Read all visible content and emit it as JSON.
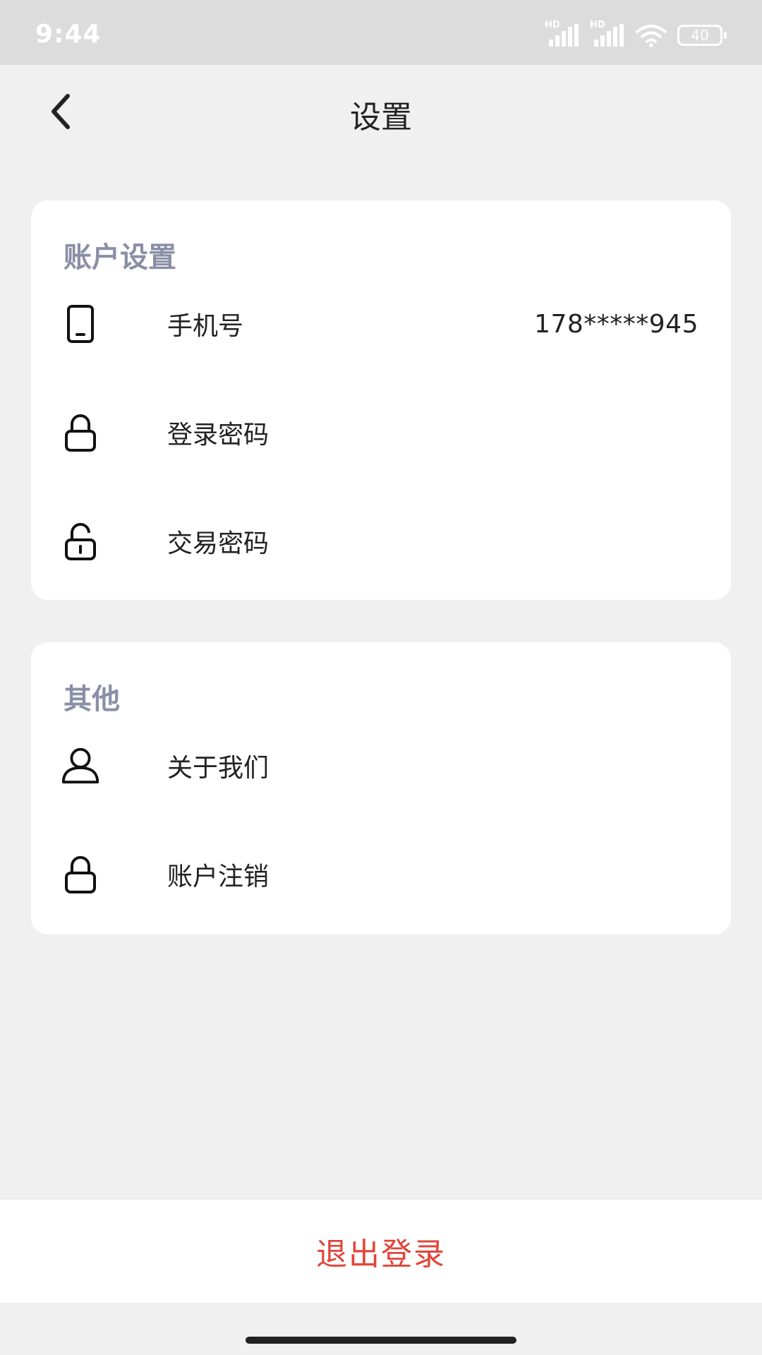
{
  "status_bar": {
    "time": "9:44",
    "hd1": "HD",
    "hd2": "HD",
    "battery": "40",
    "icons": [
      "signal-icon",
      "signal-icon",
      "wifi-icon",
      "battery-icon"
    ]
  },
  "nav": {
    "title": "设置",
    "back_icon": "chevron-left-icon"
  },
  "account_section": {
    "title": "账户设置",
    "items": [
      {
        "icon": "phone-icon",
        "label": "手机号",
        "value": "178*****945"
      },
      {
        "icon": "lock-icon",
        "label": "登录密码"
      },
      {
        "icon": "unlock-icon",
        "label": "交易密码"
      }
    ]
  },
  "other_section": {
    "title": "其他",
    "items": [
      {
        "icon": "user-icon",
        "label": "关于我们"
      },
      {
        "icon": "lock-icon",
        "label": "账户注销"
      }
    ]
  },
  "logout": {
    "label": "退出登录",
    "color": "#e0463b"
  },
  "colors": {
    "background": "#f0f0f0",
    "card": "#ffffff",
    "section_title": "#8a8fa6",
    "status_bar": "#dcdcdc"
  }
}
